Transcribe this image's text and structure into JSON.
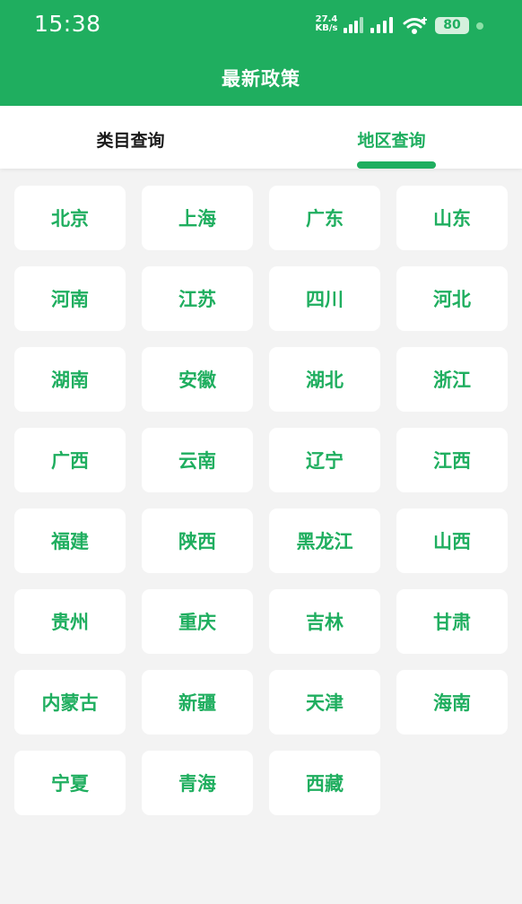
{
  "status_bar": {
    "time": "15:38",
    "net_speed_value": "27.4",
    "net_speed_unit": "KB/s",
    "battery": "80"
  },
  "header": {
    "title": "最新政策"
  },
  "tabs": [
    {
      "label": "类目查询",
      "active": false
    },
    {
      "label": "地区查询",
      "active": true
    }
  ],
  "regions": [
    "北京",
    "上海",
    "广东",
    "山东",
    "河南",
    "江苏",
    "四川",
    "河北",
    "湖南",
    "安徽",
    "湖北",
    "浙江",
    "广西",
    "云南",
    "辽宁",
    "江西",
    "福建",
    "陕西",
    "黑龙江",
    "山西",
    "贵州",
    "重庆",
    "吉林",
    "甘肃",
    "内蒙古",
    "新疆",
    "天津",
    "海南",
    "宁夏",
    "青海",
    "西藏"
  ],
  "colors": {
    "accent": "#1fae5f",
    "background": "#f3f3f3",
    "card": "#ffffff"
  },
  "icons": [
    "cellular-signal-icon",
    "wifi-icon",
    "battery-icon"
  ]
}
